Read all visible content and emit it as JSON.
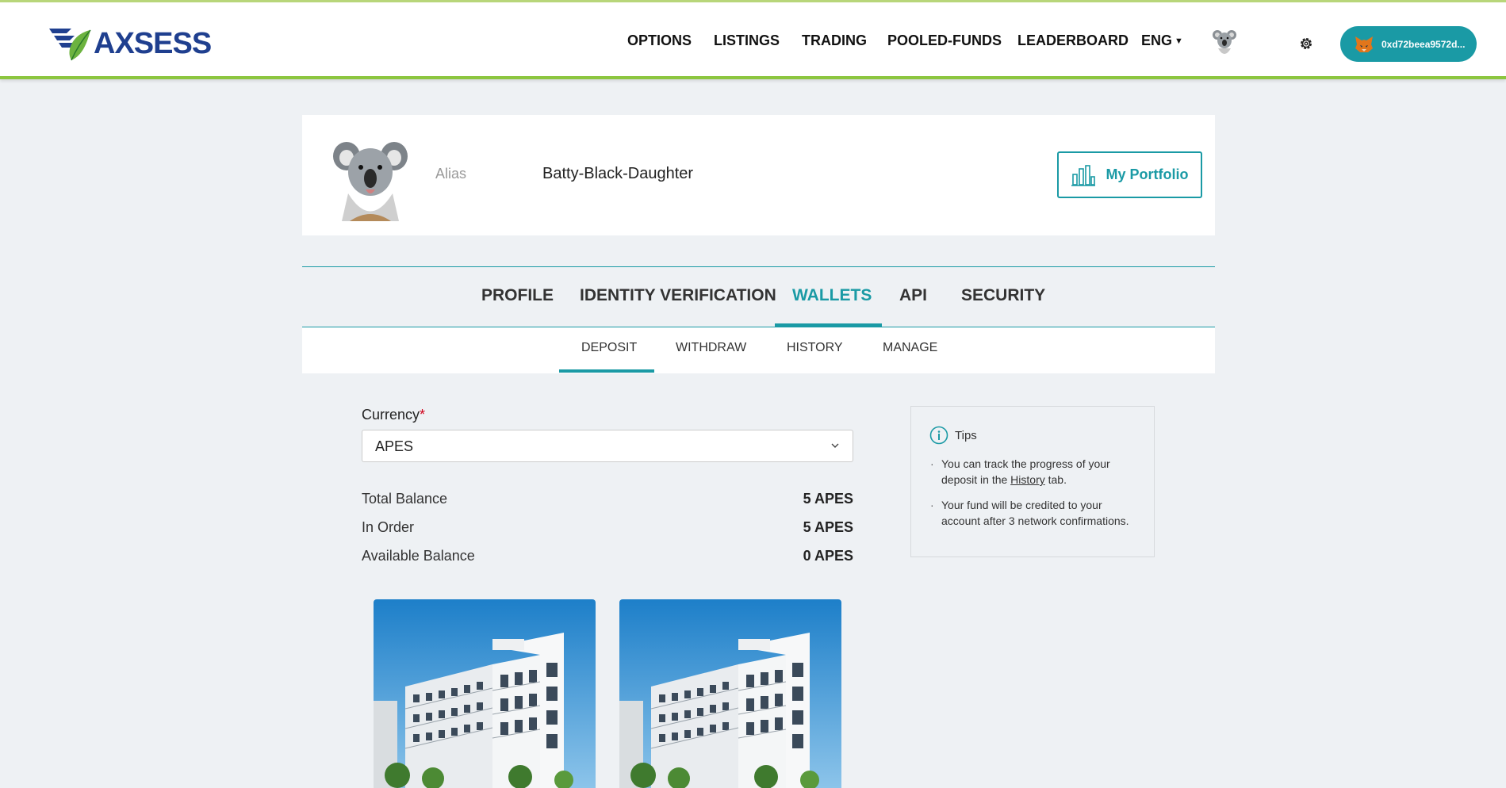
{
  "header": {
    "logo_text": "AXSESS",
    "nav": [
      "OPTIONS",
      "LISTINGS",
      "TRADING",
      "POOLED-FUNDS",
      "LEADERBOARD"
    ],
    "language": "ENG",
    "wallet_address": "0xd72beea9572d..."
  },
  "profile": {
    "alias_label": "Alias",
    "alias_value": "Batty-Black-Daughter",
    "portfolio_button": "My Portfolio"
  },
  "main_tabs": [
    "PROFILE",
    "IDENTITY VERIFICATION",
    "WALLETS",
    "API",
    "SECURITY"
  ],
  "main_tabs_active": "WALLETS",
  "sub_tabs": [
    "DEPOSIT",
    "WITHDRAW",
    "HISTORY",
    "MANAGE"
  ],
  "sub_tabs_active": "DEPOSIT",
  "deposit": {
    "currency_label": "Currency",
    "required_mark": "*",
    "currency_value": "APES",
    "balances": [
      {
        "label": "Total Balance",
        "value": "5 APES"
      },
      {
        "label": "In Order",
        "value": "5 APES"
      },
      {
        "label": "Available Balance",
        "value": "0 APES"
      }
    ]
  },
  "tips": {
    "title": "Tips",
    "tip1_before": "You can track the progress of your deposit in the ",
    "tip1_link": "History",
    "tip1_after": " tab.",
    "tip2": "Your fund will be credited to your account after 3 network confirmations."
  },
  "colors": {
    "accent": "#1a9aa5",
    "header_border": "#8cc63f",
    "background": "#eef1f4",
    "required": "#d0021b"
  },
  "icons": [
    "logo-icon",
    "koala-avatar-icon",
    "gear-icon",
    "metamask-fox-icon",
    "bar-chart-icon",
    "chevron-down-icon",
    "info-icon"
  ]
}
